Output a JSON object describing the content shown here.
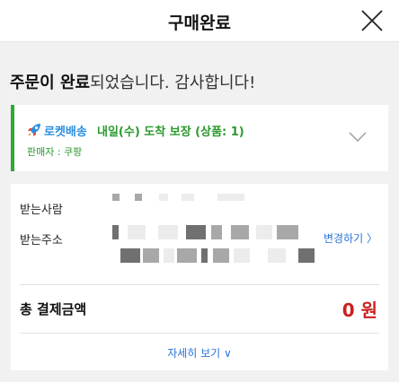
{
  "header": {
    "title": "구매완료",
    "close_icon": "close-icon"
  },
  "headline": {
    "bold": "주문이 완료",
    "rest": "되었습니다. 감사합니다!"
  },
  "delivery": {
    "rocket_icon": "rocket-icon",
    "rocket_label": "로켓배송",
    "arrival": "내일(수) 도착 보장 (상품: 1)",
    "seller": "판매자 : 쿠팡",
    "expand_icon": "chevron-down-icon",
    "accent_color": "#2eaa32"
  },
  "order": {
    "recipient_label": "받는사람",
    "address_label": "받는주소",
    "change_link": "변경하기 〉",
    "total_label": "총 결제금액",
    "total_amount": "0 원",
    "details_link": "자세히 보기 ∨",
    "amount_color": "#cc1f1f",
    "link_color": "#2a73d8"
  }
}
